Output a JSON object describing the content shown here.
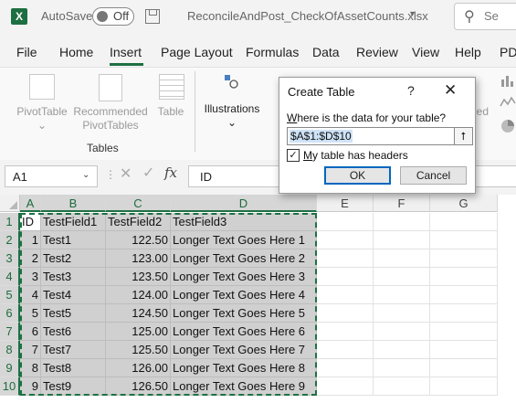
{
  "titlebar": {
    "app_icon_letter": "X",
    "autosave_label": "AutoSave",
    "autosave_state": "Off",
    "document_name": "ReconcileAndPost_CheckOfAssetCounts.xlsx",
    "search_placeholder": "Se"
  },
  "menu": {
    "file": "File",
    "home": "Home",
    "insert": "Insert",
    "page_layout": "Page Layout",
    "formulas": "Formulas",
    "data": "Data",
    "review": "Review",
    "view": "View",
    "help": "Help",
    "pdf": "PD"
  },
  "ribbon": {
    "pivottable": {
      "line1": "PivotTable",
      "line2": "⌄"
    },
    "recommended": {
      "line1": "Recommended",
      "line2": "PivotTables"
    },
    "table": "Table",
    "group_tables": "Tables",
    "illustrations": {
      "line1": "Illustrations",
      "line2": "⌄"
    },
    "partial_label": "ded"
  },
  "formula_bar": {
    "name_box": "A1",
    "cancel_glyph": "✕",
    "enter_glyph": "✓",
    "fx": "fx",
    "formula": "ID"
  },
  "grid": {
    "columns": [
      "A",
      "B",
      "C",
      "D",
      "E",
      "F",
      "G"
    ],
    "rows": [
      "1",
      "2",
      "3",
      "4",
      "5",
      "6",
      "7",
      "8",
      "9",
      "10"
    ],
    "header_row": [
      "ID",
      "TestField1",
      "TestField2",
      "TestField3"
    ],
    "data_rows": [
      [
        "1",
        "Test1",
        "122.50",
        "Longer Text Goes Here 1"
      ],
      [
        "2",
        "Test2",
        "123.00",
        "Longer Text Goes Here 2"
      ],
      [
        "3",
        "Test3",
        "123.50",
        "Longer Text Goes Here 3"
      ],
      [
        "4",
        "Test4",
        "124.00",
        "Longer Text Goes Here 4"
      ],
      [
        "5",
        "Test5",
        "124.50",
        "Longer Text Goes Here 5"
      ],
      [
        "6",
        "Test6",
        "125.00",
        "Longer Text Goes Here 6"
      ],
      [
        "7",
        "Test7",
        "125.50",
        "Longer Text Goes Here 7"
      ],
      [
        "8",
        "Test8",
        "126.00",
        "Longer Text Goes Here 8"
      ],
      [
        "9",
        "Test9",
        "126.50",
        "Longer Text Goes Here 9"
      ]
    ]
  },
  "dialog": {
    "title": "Create Table",
    "help": "?",
    "close": "✕",
    "prompt": "Where is the data for your table?",
    "range": "$A$1:$D$10",
    "range_button": "⭡",
    "checkbox_checked": true,
    "checkbox_mark": "✓",
    "checkbox_label": "My table has headers",
    "ok": "OK",
    "cancel": "Cancel"
  },
  "colors": {
    "excel_green": "#1d6f42",
    "selection_fill": "#d0d0d0",
    "default_button_border": "#0067c0"
  }
}
